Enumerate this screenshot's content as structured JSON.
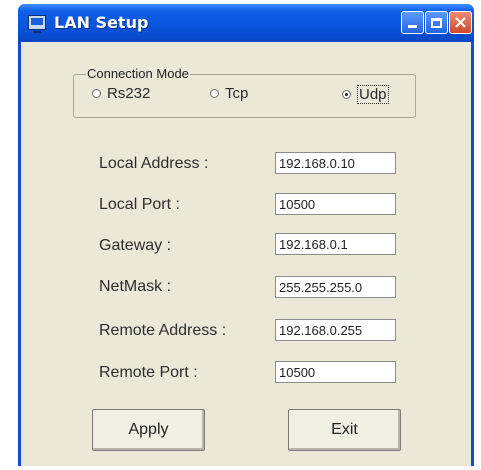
{
  "window": {
    "title": "LAN Setup",
    "controls": {
      "minimize": "minimize-icon",
      "maximize": "maximize-icon",
      "close": "close-icon"
    }
  },
  "connection_mode": {
    "label": "Connection Mode",
    "options": [
      {
        "label": "Rs232",
        "checked": false
      },
      {
        "label": "Tcp",
        "checked": false
      },
      {
        "label": "Udp",
        "checked": true
      }
    ]
  },
  "fields": [
    {
      "label": "Local Address :",
      "value": "192.168.0.10"
    },
    {
      "label": "Local Port :",
      "value": "10500"
    },
    {
      "label": "Gateway :",
      "value": "192.168.0.1"
    },
    {
      "label": "NetMask :",
      "value": "255.255.255.0"
    },
    {
      "label": "Remote Address :",
      "value": "192.168.0.255"
    },
    {
      "label": "Remote Port :",
      "value": "10500"
    }
  ],
  "buttons": {
    "apply": "Apply",
    "exit": "Exit"
  },
  "colors": {
    "titlebar": "#0a54dc",
    "client_bg": "#ebe8d8",
    "close_button": "#d1482a"
  }
}
